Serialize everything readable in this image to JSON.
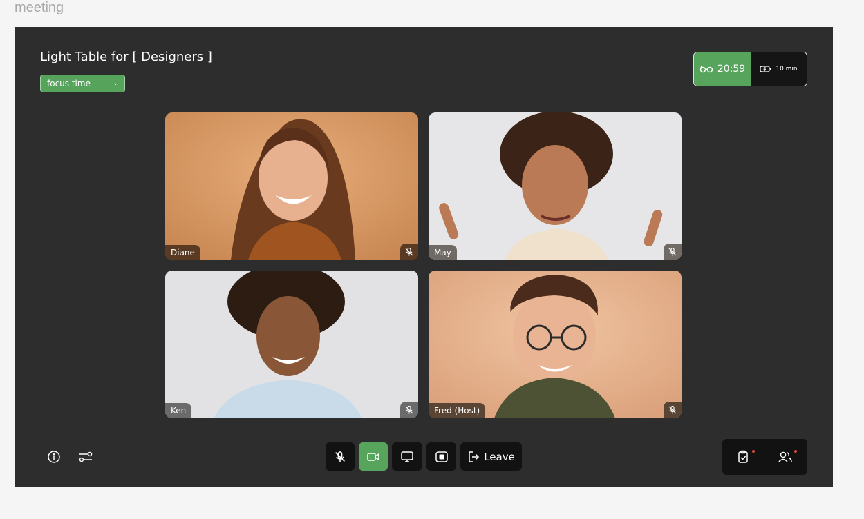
{
  "frame_label": "meeting",
  "header": {
    "title": "Light Table for  [ Designers ]",
    "mode_select": {
      "value": "focus time"
    }
  },
  "timer": {
    "time": "20:59",
    "break": "10 min"
  },
  "participants": [
    {
      "name": "Diane",
      "muted": true
    },
    {
      "name": "May",
      "muted": true
    },
    {
      "name": "Ken",
      "muted": true
    },
    {
      "name": "Fred (Host)",
      "muted": true
    }
  ],
  "controls": {
    "leave_label": "Leave",
    "camera_on": true
  },
  "colors": {
    "accent": "#57a45c",
    "background": "#2d2d2d",
    "notification": "#e24a3b"
  }
}
